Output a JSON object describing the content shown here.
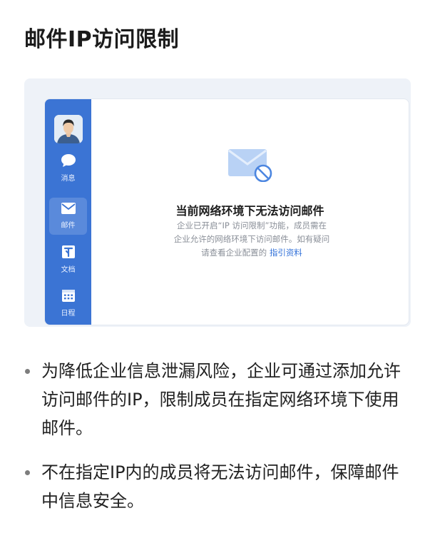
{
  "page_title": "邮件IP访问限制",
  "sidebar": {
    "items": [
      {
        "label": "消息",
        "icon": "chat-bubble-icon"
      },
      {
        "label": "邮件",
        "icon": "mail-icon",
        "active": true
      },
      {
        "label": "文档",
        "icon": "document-icon"
      },
      {
        "label": "日程",
        "icon": "calendar-icon"
      }
    ]
  },
  "empty_state": {
    "icon": "mail-blocked-icon",
    "title": "当前网络环境下无法访问邮件",
    "desc_line1": "企业已开启“IP 访问限制”功能，成员需在",
    "desc_line2": "企业允许的网络环境下访问邮件。如有疑问",
    "desc_line3_prefix": "请查看企业配置的 ",
    "guide_link": "指引资料"
  },
  "bullets": [
    "为降低企业信息泄漏风险，企业可通过添加允许访问邮件的IP，限制成员在指定网络环境下使用邮件。",
    "不在指定IP内的成员将无法访问邮件，保障邮件中信息安全。"
  ],
  "colors": {
    "sidebar": "#3b74d4",
    "link": "#2f6fd8",
    "card_bg": "#eef2f8"
  }
}
